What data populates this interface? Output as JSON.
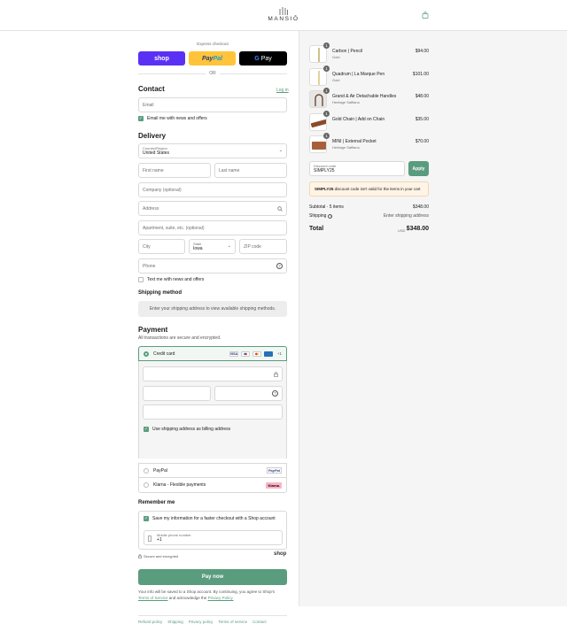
{
  "brand": {
    "name": "MANSIŌ"
  },
  "express": {
    "label": "Express checkout",
    "shop": "shop",
    "paypal_a": "Pay",
    "paypal_b": "Pal",
    "gpay_g": "G",
    "gpay_pay": "Pay",
    "or": "OR"
  },
  "contact": {
    "title": "Contact",
    "login": "Log in",
    "email_placeholder": "Email",
    "newsletter": "Email me with news and offers"
  },
  "delivery": {
    "title": "Delivery",
    "country_label": "Country/Region",
    "country_value": "United States",
    "first_name": "First name",
    "last_name": "Last name",
    "company": "Company (optional)",
    "address": "Address",
    "apartment": "Apartment, suite, etc. (optional)",
    "city": "City",
    "state_label": "State",
    "state_value": "Iowa",
    "zip": "ZIP code",
    "phone": "Phone",
    "text_me": "Text me with news and offers"
  },
  "shipping_method": {
    "title": "Shipping method",
    "message": "Enter your shipping address to view available shipping methods."
  },
  "payment": {
    "title": "Payment",
    "subtitle": "All transactions are secure and encrypted.",
    "credit_card": "Credit card",
    "more_cards": "+1",
    "billing_same": "Use shipping address as billing address",
    "paypal": "PayPal",
    "klarna": "Klarna - Flexible payments",
    "klarna_badge": "Klarna."
  },
  "remember": {
    "title": "Remember me",
    "save_info": "Save my information for a faster checkout with a Shop account",
    "phone_label": "Mobile phone number",
    "phone_value": "+1",
    "secure": "Secure and encrypted",
    "shop_logo": "shop"
  },
  "pay_now": "Pay now",
  "legal": {
    "text": "Your info will be saved to a Shop account. By continuing, you agree to Shop's",
    "terms": "Terms of Service",
    "and": "and acknowledge the",
    "privacy": "Privacy Policy."
  },
  "footer_links": [
    "Refund policy",
    "Shipping",
    "Privacy policy",
    "Terms of service",
    "Contact"
  ],
  "order": {
    "items": [
      {
        "qty": "1",
        "name": "Carbon | Pencil",
        "variant": "Gold",
        "price": "$94.00"
      },
      {
        "qty": "1",
        "name": "Quadrum | La Marque Pen",
        "variant": "Gold",
        "price": "$101.00"
      },
      {
        "qty": "1",
        "name": "Grand & Air Detachable Handles",
        "variant": "Heritage Saffiano",
        "price": "$48.00"
      },
      {
        "qty": "1",
        "name": "Gold Chain | Add on Chain",
        "variant": "",
        "price": "$35.00"
      },
      {
        "qty": "1",
        "name": "MINI | External Pocket",
        "variant": "Heritage Saffiano",
        "price": "$70.00"
      }
    ],
    "discount_label": "Discount code",
    "discount_value": "SIMPLY25",
    "apply": "Apply",
    "warning_code": "SIMPLY25",
    "warning_text": "discount code isn't valid for the items in your cart",
    "subtotal_label": "Subtotal · 5 items",
    "subtotal": "$348.00",
    "shipping_label": "Shipping",
    "shipping_value": "Enter shipping address",
    "total_label": "Total",
    "currency": "USD",
    "total": "$348.00"
  },
  "colors": {
    "accent": "#5a9c7e",
    "shop": "#5a31f4",
    "paypal": "#ffc439"
  }
}
